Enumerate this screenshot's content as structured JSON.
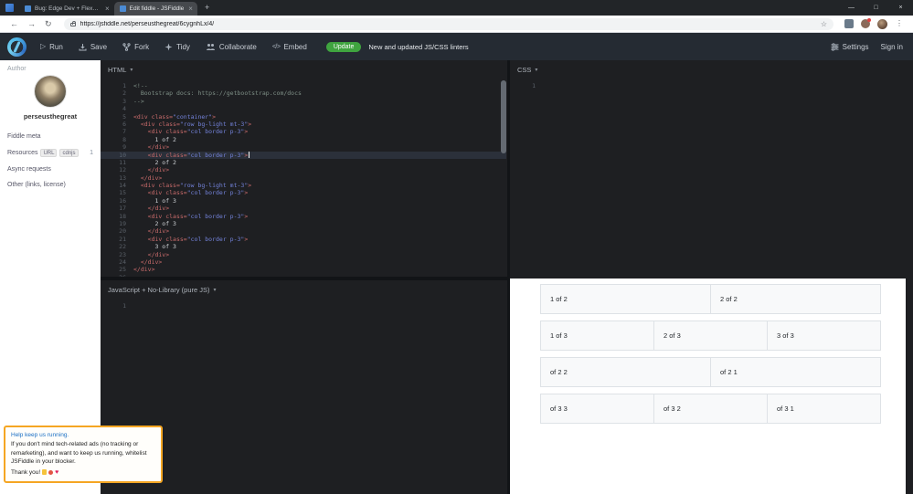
{
  "browser": {
    "tabs": [
      {
        "title": "Bug: Edge Dev + FlexBox + RTL :..."
      },
      {
        "title": "Edit fiddle - JSFiddle"
      }
    ],
    "tab_close": "×",
    "new_tab": "+",
    "url": "https://jsfiddle.net/perseusthegreat/6cygnhLx/4/",
    "controls": {
      "minimize": "—",
      "maximize": "□",
      "close": "×"
    },
    "nav": {
      "back": "←",
      "forward": "→",
      "reload": "↻",
      "star": "☆",
      "menu": "⋮"
    }
  },
  "toolbar": {
    "play_glyph": "▷",
    "run": "Run",
    "save": "Save",
    "fork": "Fork",
    "tidy": "Tidy",
    "collaborate": "Collaborate",
    "embed_glyph": "</>",
    "embed": "Embed",
    "update_badge": "Update",
    "update_text": "New and updated JS/CSS linters",
    "settings": "Settings",
    "sign_in": "Sign in"
  },
  "sidebar": {
    "author_label": "Author",
    "username": "perseusthegreat",
    "meta_label": "Fiddle meta",
    "resources_label": "Resources",
    "resources_url": "URL",
    "resources_cdnjs": "cdnjs",
    "resources_count": "1",
    "async_label": "Async requests",
    "other_label": "Other (links, license)"
  },
  "adbox": {
    "title": "Help keep us running.",
    "body": "If you don't mind tech-related ads (no tracking or remarketing), and want to keep us running, whitelist JSFiddle in your blocker.",
    "thanks": "Thank you!",
    "emoji_icons": [
      "horns-hand",
      "red-circle",
      "heart"
    ],
    "heart_glyph": "♥"
  },
  "panels": {
    "html": {
      "label": "HTML",
      "caret": "▾",
      "active_line": 10,
      "code_lines": [
        [
          [
            "c",
            "<!--"
          ]
        ],
        [
          [
            "c",
            "  Bootstrap docs: https://getbootstrap.com/docs"
          ]
        ],
        [
          [
            "c",
            "-->"
          ]
        ],
        [],
        [
          [
            "t",
            "<div class="
          ],
          [
            "s",
            "\"container\""
          ],
          [
            "t",
            ">"
          ]
        ],
        [
          [
            "t",
            "  <div class="
          ],
          [
            "s",
            "\"row bg-light mt-3\""
          ],
          [
            "t",
            ">"
          ]
        ],
        [
          [
            "t",
            "    <div class="
          ],
          [
            "s",
            "\"col border p-3\""
          ],
          [
            "t",
            ">"
          ]
        ],
        [
          [
            "x",
            "      1 of 2"
          ]
        ],
        [
          [
            "t",
            "    </div>"
          ]
        ],
        [
          [
            "t",
            "    <div class="
          ],
          [
            "s",
            "\"col border p-3\""
          ],
          [
            "t",
            ">"
          ]
        ],
        [
          [
            "x",
            "      2 of 2"
          ]
        ],
        [
          [
            "t",
            "    </div>"
          ]
        ],
        [
          [
            "t",
            "  </div>"
          ]
        ],
        [
          [
            "t",
            "  <div class="
          ],
          [
            "s",
            "\"row bg-light mt-3\""
          ],
          [
            "t",
            ">"
          ]
        ],
        [
          [
            "t",
            "    <div class="
          ],
          [
            "s",
            "\"col border p-3\""
          ],
          [
            "t",
            ">"
          ]
        ],
        [
          [
            "x",
            "      1 of 3"
          ]
        ],
        [
          [
            "t",
            "    </div>"
          ]
        ],
        [
          [
            "t",
            "    <div class="
          ],
          [
            "s",
            "\"col border p-3\""
          ],
          [
            "t",
            ">"
          ]
        ],
        [
          [
            "x",
            "      2 of 3"
          ]
        ],
        [
          [
            "t",
            "    </div>"
          ]
        ],
        [
          [
            "t",
            "    <div class="
          ],
          [
            "s",
            "\"col border p-3\""
          ],
          [
            "t",
            ">"
          ]
        ],
        [
          [
            "x",
            "      3 of 3"
          ]
        ],
        [
          [
            "t",
            "    </div>"
          ]
        ],
        [
          [
            "t",
            "  </div>"
          ]
        ],
        [
          [
            "t",
            "</div>"
          ]
        ],
        []
      ]
    },
    "css": {
      "label": "CSS",
      "caret": "▾",
      "first_line_number": "1"
    },
    "js": {
      "label": "JavaScript + No-Library (pure JS)",
      "caret": "▾",
      "first_line_number": "1"
    },
    "result": {
      "rows": [
        [
          "1 of 2",
          "2 of 2"
        ],
        [
          "1 of 3",
          "2 of 3",
          "3 of 3"
        ],
        [
          "of 2 2",
          "of 2 1"
        ],
        [
          "of 3 3",
          "of 3 2",
          "of 3 1"
        ]
      ]
    }
  },
  "colors": {
    "update_green": "#3fa43f",
    "ad_border_orange": "#f5a623",
    "editor_bg": "#1e1f22",
    "result_row_bg": "#f8f9fa",
    "result_border": "#dee2e6"
  }
}
